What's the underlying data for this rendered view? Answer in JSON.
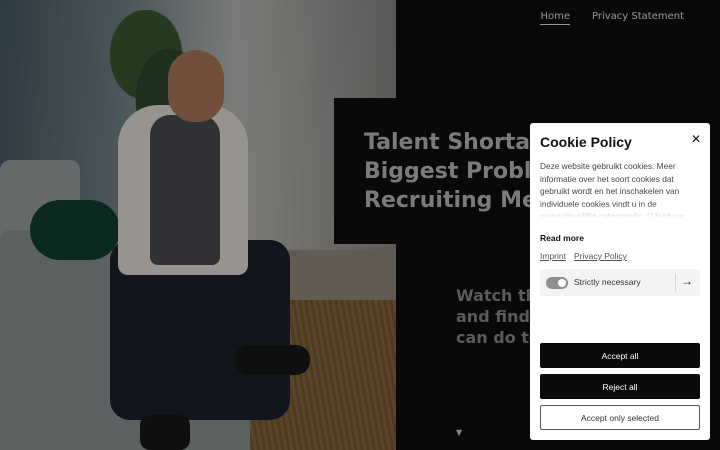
{
  "nav": {
    "items": [
      {
        "label": "Home",
        "active": true
      },
      {
        "label": "Privacy Statement",
        "active": false
      }
    ]
  },
  "hero": {
    "headline": "Talent Shortag\nBiggest Problen\nRecruiting Meth",
    "subtext": "Watch th\nand find o\ncan do to",
    "scroll_icon": "caret-down-icon"
  },
  "cookie": {
    "title": "Cookie Policy",
    "close_icon": "close-icon",
    "description": "Deze website gebruikt cookies. Meer informatie over het soort cookies dat gebruikt wordt en het inschakelen van individuele cookies vindt u in de respectievelijke categorieën. U kunt uw",
    "read_more": "Read more",
    "imprint": "Imprint",
    "privacy_policy": "Privacy Policy",
    "category": {
      "label": "Strictly necessary",
      "enabled": true
    },
    "accept_all": "Accept all",
    "reject_all": "Reject all",
    "accept_selected": "Accept only selected"
  },
  "colors": {
    "background": "#0f0f10",
    "button_dark": "#0b0b0b",
    "headline": "#bdbdbd"
  }
}
